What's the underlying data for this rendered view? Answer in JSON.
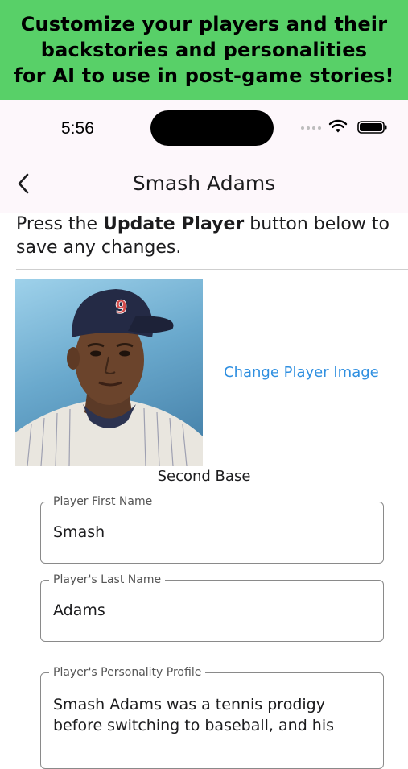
{
  "banner": {
    "text": "Customize your players and their\nbackstories and personalities\nfor AI to use in post-game stories!"
  },
  "status_bar": {
    "time": "5:56"
  },
  "navbar": {
    "title": "Smash Adams"
  },
  "instruction": {
    "prefix": "Press the ",
    "bold": "Update Player",
    "suffix": " button below to save any changes."
  },
  "player": {
    "jersey_number": "9",
    "change_image_label": "Change Player Image",
    "position": "Second Base"
  },
  "fields": {
    "first_name": {
      "label": "Player First Name",
      "value": "Smash"
    },
    "last_name": {
      "label": "Player's Last Name",
      "value": "Adams"
    },
    "personality": {
      "label": "Player's Personality Profile",
      "value": "Smash Adams was a tennis prodigy before switching to baseball, and his"
    }
  },
  "colors": {
    "banner_bg": "#58d068",
    "link": "#2f8fe0",
    "header_bg": "#fdf7fb"
  },
  "icons": [
    "chevron-left-icon",
    "wifi-icon",
    "battery-icon",
    "signal-icon"
  ]
}
